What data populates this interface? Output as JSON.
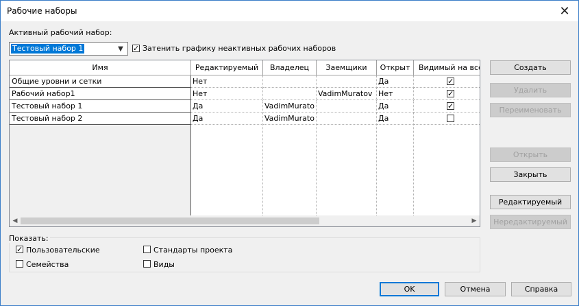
{
  "window": {
    "title": "Рабочие наборы"
  },
  "active_workset": {
    "label": "Активный рабочий набор:",
    "value": "Тестовый набор 1"
  },
  "gray_inactive": {
    "label": "Затенить графику неактивных рабочих наборов",
    "checked": true
  },
  "table": {
    "columns": [
      "Имя",
      "Редактируемый",
      "Владелец",
      "Заемщики",
      "Открыт",
      "Видимый на всех"
    ],
    "rows": [
      {
        "name": "Общие уровни и сетки",
        "editable": "Нет",
        "owner": "",
        "borrowers": "",
        "open": "Да",
        "visible": true
      },
      {
        "name": "Рабочий набор1",
        "editable": "Нет",
        "owner": "",
        "borrowers": "VadimMuratov",
        "open": "Нет",
        "visible": true
      },
      {
        "name": "Тестовый набор 1",
        "editable": "Да",
        "owner": "VadimMurato",
        "borrowers": "",
        "open": "Да",
        "visible": true
      },
      {
        "name": "Тестовый набор 2",
        "editable": "Да",
        "owner": "VadimMurato",
        "borrowers": "",
        "open": "Да",
        "visible": false
      }
    ]
  },
  "side_buttons": {
    "create": "Создать",
    "delete": "Удалить",
    "rename": "Переименовать",
    "open": "Открыть",
    "close": "Закрыть",
    "editable": "Редактируемый",
    "non_editable": "Нередактируемый"
  },
  "show": {
    "label": "Показать:",
    "user": {
      "label": "Пользовательские",
      "checked": true
    },
    "families": {
      "label": "Семейства",
      "checked": false
    },
    "project_standards": {
      "label": "Стандарты проекта",
      "checked": false
    },
    "views": {
      "label": "Виды",
      "checked": false
    }
  },
  "footer": {
    "ok": "OK",
    "cancel": "Отмена",
    "help": "Справка"
  },
  "icons": {
    "close": "close-icon",
    "dropdown": "chevron-down-icon",
    "scroll_left": "arrow-left-icon",
    "scroll_right": "arrow-right-icon"
  }
}
